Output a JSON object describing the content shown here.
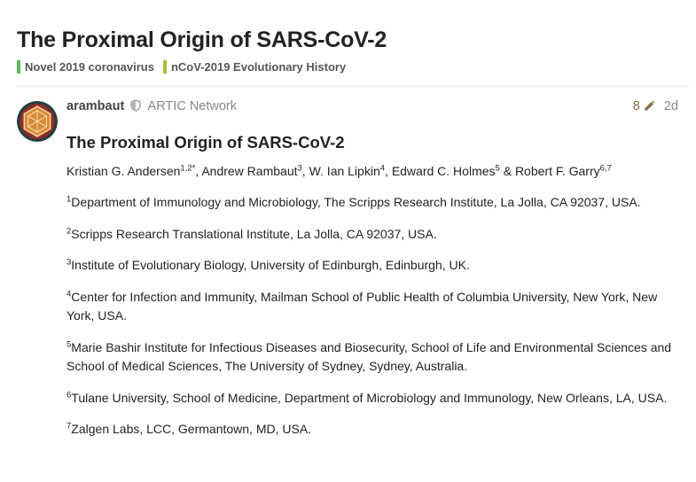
{
  "topic": {
    "title": "The Proximal Origin of SARS-CoV-2",
    "categories": [
      {
        "label": "Novel 2019 coronavirus",
        "color": "#5cb85c"
      },
      {
        "label": "nCoV-2019 Evolutionary History",
        "color": "#9ec23a"
      }
    ]
  },
  "post": {
    "username": "arambaut",
    "group": "ARTIC Network",
    "edit_count": "8",
    "age": "2d",
    "heading": "The Proximal Origin of SARS-CoV-2",
    "authors": [
      {
        "name": "Kristian G. Andersen",
        "sup": "1,2*",
        "sep": ", "
      },
      {
        "name": "Andrew Rambaut",
        "sup": "3",
        "sep": ", "
      },
      {
        "name": "W. Ian Lipkin",
        "sup": "4",
        "sep": ", "
      },
      {
        "name": "Edward C. Holmes",
        "sup": "5",
        "sep": " & "
      },
      {
        "name": "Robert F. Garry",
        "sup": "6,7",
        "sep": ""
      }
    ],
    "affiliations": [
      {
        "num": "1",
        "text": "Department of Immunology and Microbiology, The Scripps Research Institute, La Jolla, CA 92037, USA."
      },
      {
        "num": "2",
        "text": "Scripps Research Translational Institute, La Jolla, CA 92037, USA."
      },
      {
        "num": "3",
        "text": "Institute of Evolutionary Biology, University of Edinburgh, Edinburgh, UK."
      },
      {
        "num": "4",
        "text": "Center for Infection and Immunity, Mailman School of Public Health of Columbia University, New York, New York, USA."
      },
      {
        "num": "5",
        "text": "Marie Bashir Institute for Infectious Diseases and Biosecurity, School of Life and Environmental Sciences and School of Medical Sciences, The University of Sydney, Sydney, Australia."
      },
      {
        "num": "6",
        "text": "Tulane University, School of Medicine, Department of Microbiology and Immunology, New Orleans, LA, USA."
      },
      {
        "num": "7",
        "text": "Zalgen Labs, LCC, Germantown, MD, USA."
      }
    ]
  },
  "icons": {
    "avatar": "hexagon-avatar-icon",
    "group_badge": "shield-icon",
    "edit": "pencil-icon"
  }
}
